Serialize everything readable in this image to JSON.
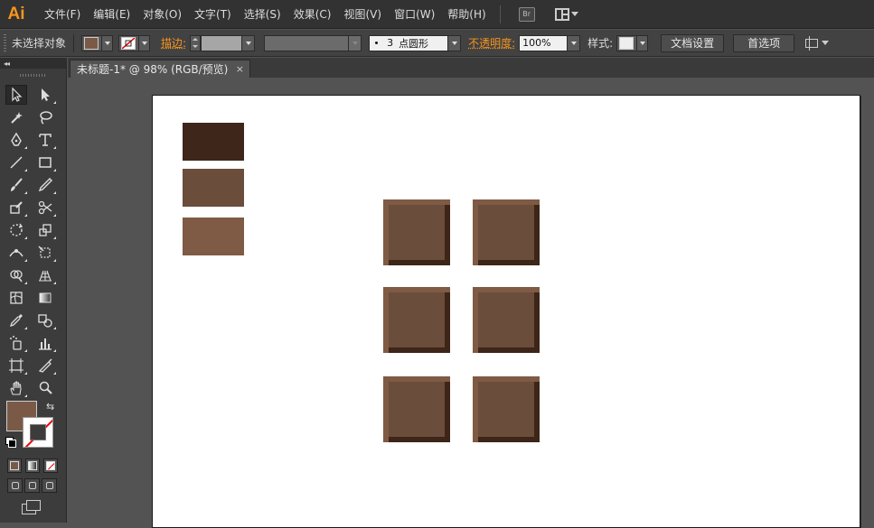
{
  "app": {
    "logo": "Ai"
  },
  "menu": [
    "文件(F)",
    "编辑(E)",
    "对象(O)",
    "文字(T)",
    "选择(S)",
    "效果(C)",
    "视图(V)",
    "窗口(W)",
    "帮助(H)"
  ],
  "bridge_label": "Br",
  "control": {
    "selection": "未选择对象",
    "fill_color": "#7a5a47",
    "stroke_label": "描边:",
    "brush_size": "3",
    "brush_name": "点圆形",
    "opacity_label": "不透明度:",
    "opacity_value": "100%",
    "style_label": "样式:",
    "doc_setup": "文档设置",
    "prefs": "首选项"
  },
  "toolpanel": {
    "collapse": "◂◂"
  },
  "document": {
    "tab_title": "未标题-1* @ 98% (RGB/预览)",
    "close": "×"
  },
  "colors": {
    "swatches": [
      "#3f261a",
      "#6b4d3b",
      "#7f5a44"
    ],
    "tile_edge": "#7f5a44",
    "tile_face": "#6b4d3b",
    "tile_shadow": "#3d2518"
  }
}
